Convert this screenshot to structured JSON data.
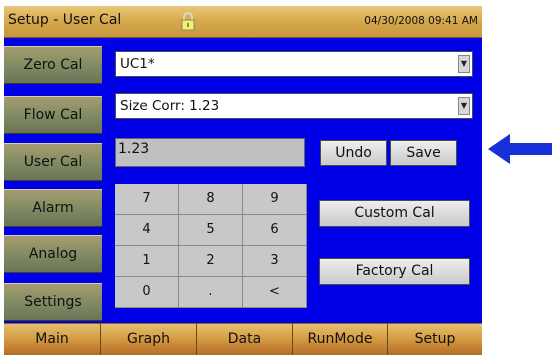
{
  "title": "Setup - User Cal",
  "datetime": "04/30/2008 09:41 AM",
  "side_menu": [
    "Zero Cal",
    "Flow Cal",
    "User Cal",
    "Alarm",
    "Analog",
    "Settings"
  ],
  "cal_select": {
    "value": "UC1*"
  },
  "size_corr_select": {
    "value": "Size Corr: 1.23"
  },
  "value_display": "1.23",
  "buttons": {
    "undo": "Undo",
    "save": "Save",
    "custom_cal": "Custom Cal",
    "factory_cal": "Factory Cal"
  },
  "keypad": [
    "7",
    "8",
    "9",
    "4",
    "5",
    "6",
    "1",
    "2",
    "3",
    "0",
    ".",
    "<"
  ],
  "tabs": [
    "Main",
    "Graph",
    "Data",
    "RunMode",
    "Setup"
  ],
  "colors": {
    "screen_bg": "#0000e6",
    "arrow": "#1830d8"
  },
  "icons": {
    "lock": "lock-icon",
    "dropdown_arrow": "dropdown-arrow-icon",
    "pointer_arrow": "left-arrow-icon"
  }
}
